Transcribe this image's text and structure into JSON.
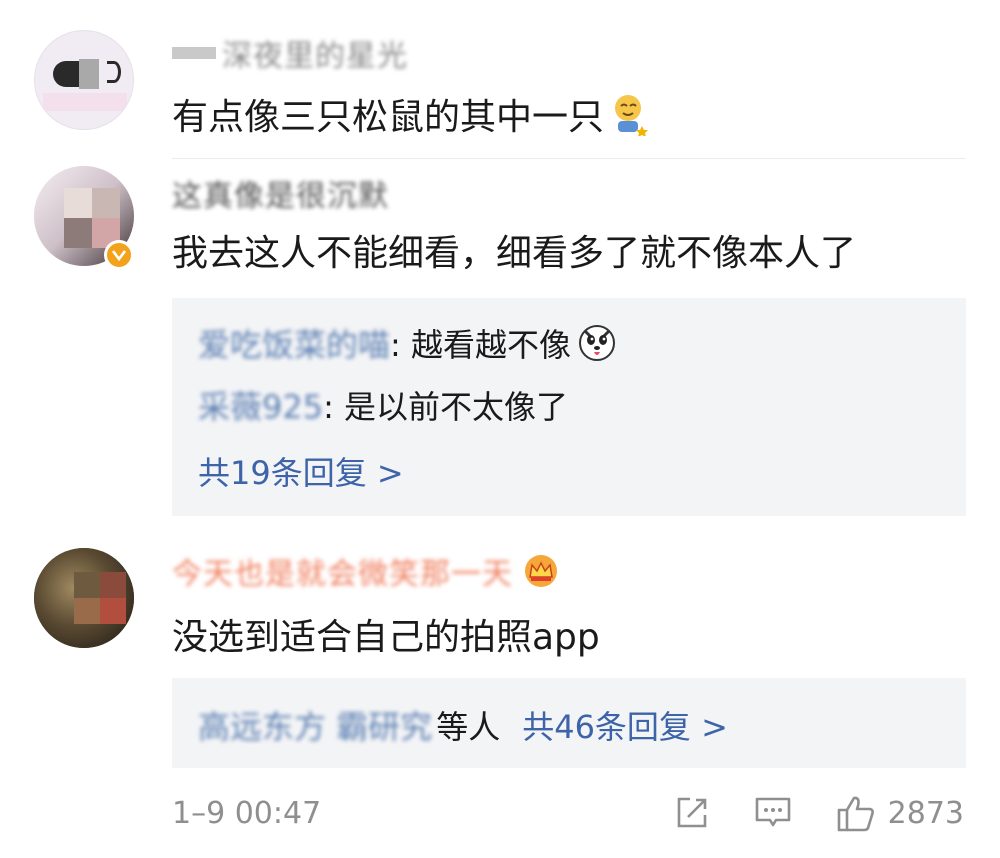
{
  "comments": [
    {
      "name": "深夜里的星光",
      "text": "有点像三只松鼠的其中一只",
      "emoji": "sleepy-smile-emoji"
    },
    {
      "name": "这真像是很沉默",
      "text": "我去这人不能细看，细看多了就不像本人了",
      "verified": true,
      "replies": [
        {
          "name": "爱吃饭菜的喵",
          "text": ": 越看越不像",
          "emoji": "husky-dog-emoji"
        },
        {
          "name": "采薇925",
          "text": ": 是以前不太像了"
        }
      ],
      "more": "共19条回复 >"
    },
    {
      "name": "今天也是就会微笑那一天",
      "text": "没选到适合自己的拍照app",
      "badge": "crown-badge-icon",
      "reply_summary": {
        "names": "高远东方 霸研究",
        "suffix": "等人",
        "more": "共46条回复 >"
      }
    }
  ],
  "footer": {
    "time": "1–9 00:47",
    "likes": "2873",
    "icons": [
      "share-icon",
      "comment-icon",
      "like-icon"
    ]
  },
  "colors": {
    "link": "#3d63a8",
    "reply_bg": "#f3f4f6",
    "muted": "#8f8f8f"
  }
}
